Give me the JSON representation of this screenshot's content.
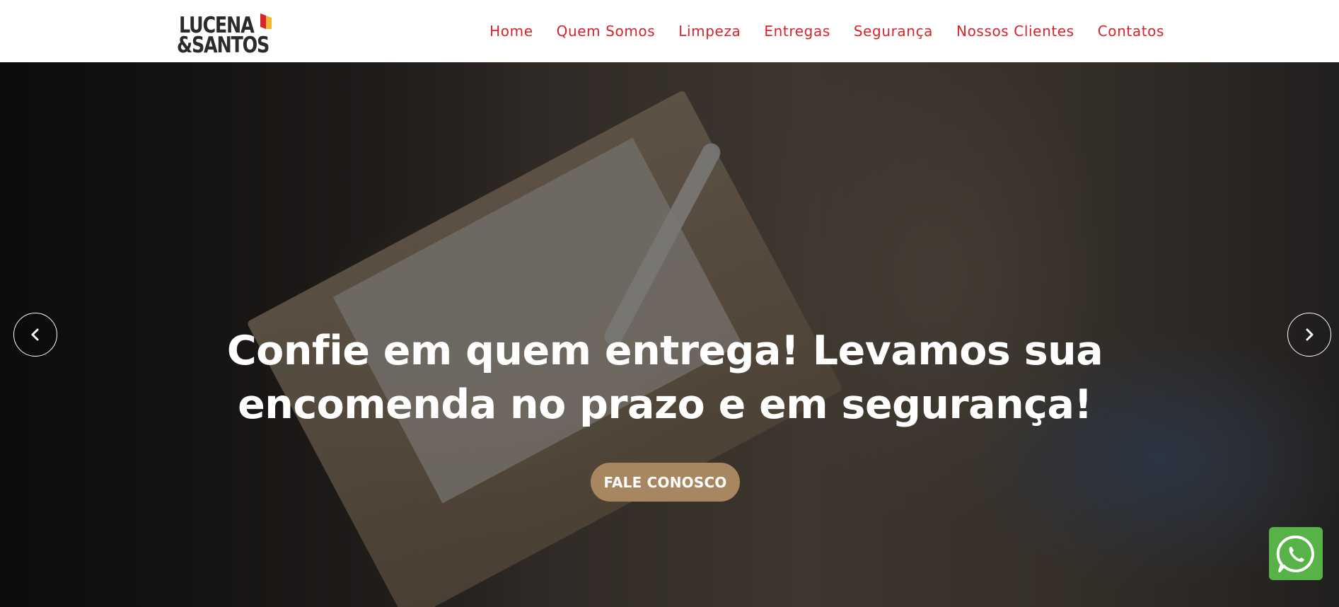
{
  "logo": {
    "line1": "LUCENA",
    "line2": "&SANTOS",
    "flag_colors": [
      "#d8232a",
      "#f2b632"
    ]
  },
  "nav": {
    "items": [
      "Home",
      "Quem Somos",
      "Limpeza",
      "Entregas",
      "Segurança",
      "Nossos Clientes",
      "Contatos"
    ],
    "color": "#d8232a"
  },
  "hero": {
    "headline_line1": "Confie em quem entrega! Levamos sua",
    "headline_line2": "encomenda no prazo e em segurança!",
    "cta_label": "FALE CONOSCO",
    "cta_color": "#a88760",
    "prev_icon": "chevron-left-icon",
    "next_icon": "chevron-right-icon"
  },
  "whatsapp": {
    "icon": "whatsapp-icon",
    "color": "#57b247"
  }
}
